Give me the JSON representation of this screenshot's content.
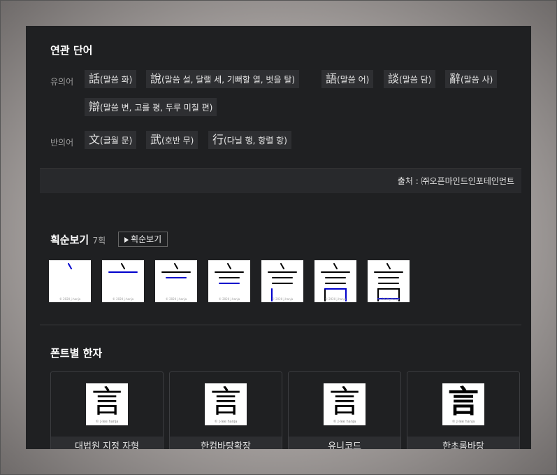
{
  "related": {
    "title": "연관 단어",
    "synonyms_label": "유의어",
    "synonyms": [
      {
        "han": "話",
        "gloss": "(말씀 화)"
      },
      {
        "han": "說",
        "gloss": "(말씀 설, 달랠 세, 기뻐할 열, 벗을 탈)"
      },
      {
        "han": "語",
        "gloss": "(말씀 어)"
      },
      {
        "han": "談",
        "gloss": "(말씀 담)"
      },
      {
        "han": "辭",
        "gloss": "(말씀 사)"
      },
      {
        "han": "辯",
        "gloss": "(말씀 변, 고를 평, 두루 미칠 편)"
      }
    ],
    "antonyms_label": "반의어",
    "antonyms": [
      {
        "han": "文",
        "gloss": "(글월 문)"
      },
      {
        "han": "武",
        "gloss": "(호반 무)"
      },
      {
        "han": "行",
        "gloss": "(다닐 행, 항렬 항)"
      }
    ],
    "source": "출처 : ㈜오픈마인드인포테인먼트"
  },
  "strokes": {
    "title": "획순보기",
    "count": "7획",
    "button_label": "획순보기",
    "watermark": "© 2020 j-hanja",
    "step_count": 7
  },
  "fonts": {
    "title": "폰트별 한자",
    "glyph": "言",
    "watermark": "© J·lee hanja",
    "cards": [
      {
        "label": "대법원 지정 자형"
      },
      {
        "label": "한컴바탕확장"
      },
      {
        "label": "유니코드"
      },
      {
        "label": "한초롬바탕"
      }
    ]
  },
  "colors": {
    "panel_bg": "#1f2022",
    "chip_bg": "#2e2f32",
    "stroke_prev": "#000000",
    "stroke_current": "#0000cc"
  }
}
